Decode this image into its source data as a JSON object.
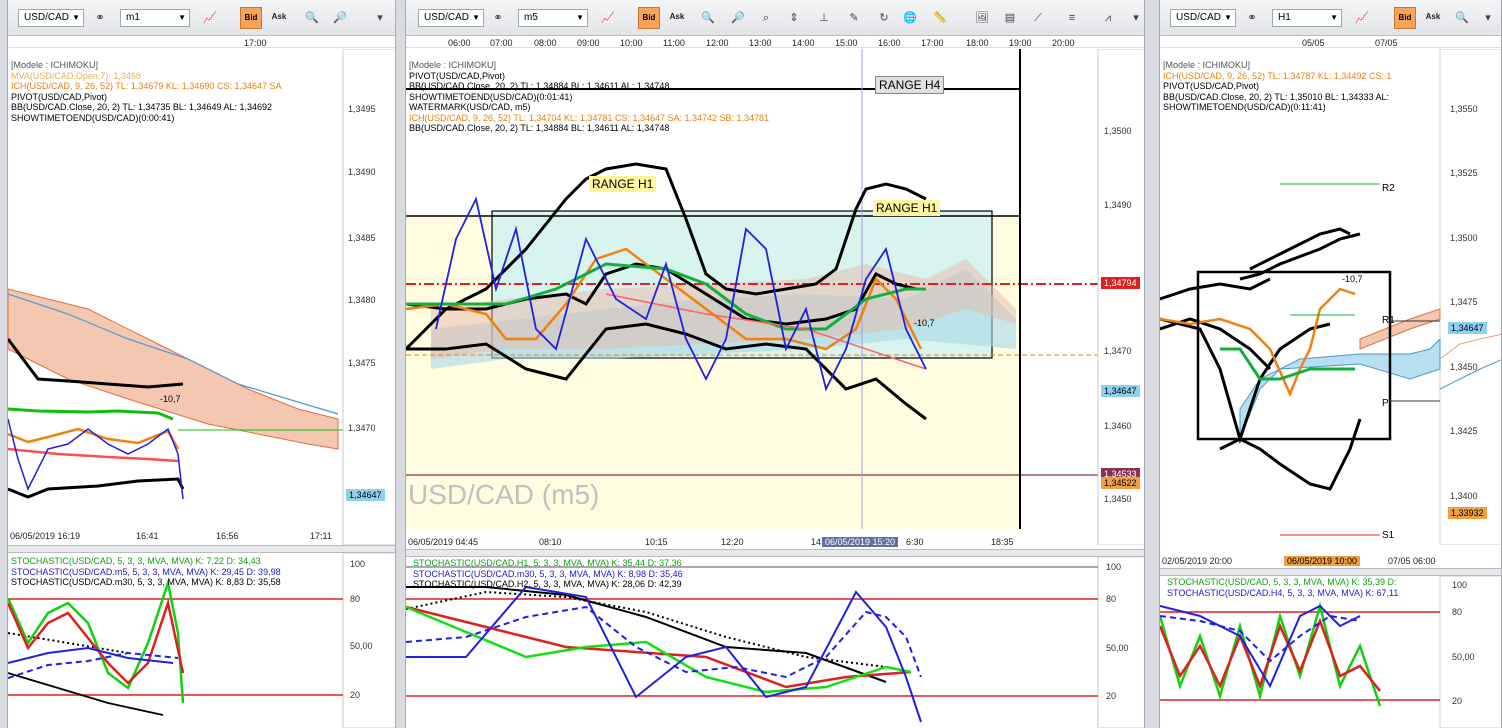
{
  "common": {
    "bid": "Bid",
    "ask": "Ask",
    "symbol": "USD/CAD",
    "stoch_labels": {
      "s100": "100",
      "s80": "80",
      "s50": "50,00",
      "s20": "20"
    }
  },
  "left": {
    "timeframe": "m1",
    "top_times": [
      "17:00"
    ],
    "legend": [
      {
        "text": "[Modele : ICHIMOKU]",
        "color": "#555555"
      },
      {
        "text": "MVA(USD/CAD.Open,7): 1,3468",
        "color": "#e0b060"
      },
      {
        "text": "ICH(USD/CAD, 9, 26, 52)  TL: 1,34679  KL: 1,34690  CS: 1,34647  SA",
        "color": "#e88010"
      },
      {
        "text": "PIVOT(USD/CAD,Pivot)",
        "color": "#000000"
      },
      {
        "text": "BB(USD/CAD.Close, 20, 2)  TL: 1,34735  BL: 1,34649  AL: 1,34692",
        "color": "#000000"
      },
      {
        "text": "SHOWTIMETOEND(USD/CAD)(0:00:41)",
        "color": "#000000"
      }
    ],
    "price_ticks": [
      "1,3495",
      "1,3490",
      "1,3485",
      "1,3480",
      "1,3475",
      "1,3470",
      "1,3465"
    ],
    "price_tag": "1,34647",
    "marker": "-10,7",
    "date_axis": [
      "06/05/2019 16:19",
      "16:41",
      "16:56",
      "17:11"
    ],
    "stoch_legend": [
      {
        "text": "STOCHASTIC(USD/CAD, 5, 3, 3, MVA, MVA)  K: 7,22  D: 34,43",
        "color": "#10a010"
      },
      {
        "text": "STOCHASTIC(USD/CAD.m5, 5, 3, 3, MVA, MVA)  K: 29,45  D: 39,98",
        "color": "#1a1ad0"
      },
      {
        "text": "STOCHASTIC(USD/CAD.m30, 5, 3, 3, MVA, MVA)  K: 8,83  D: 35,58",
        "color": "#000000"
      }
    ]
  },
  "mid": {
    "timeframe": "m5",
    "top_times": [
      "06:00",
      "07:00",
      "08:00",
      "09:00",
      "10:00",
      "11:00",
      "12:00",
      "13:00",
      "14:00",
      "15:00",
      "16:00",
      "17:00",
      "18:00",
      "19:00",
      "20:00"
    ],
    "legend": [
      {
        "text": "[Modele : ICHIMOKU]",
        "color": "#555555"
      },
      {
        "text": "PIVOT(USD/CAD,Pivot)",
        "color": "#000000"
      },
      {
        "text": "BB(USD/CAD.Close, 20, 2)  TL: 1,34884  BL: 1,34611  AL: 1,34748",
        "color": "#000000"
      },
      {
        "text": "SHOWTIMETOEND(USD/CAD)(0:01:41)",
        "color": "#000000"
      },
      {
        "text": "WATERMARK(USD/CAD, m5)",
        "color": "#000000"
      },
      {
        "text": "ICH(USD/CAD, 9, 26, 52)  TL: 1,34704  KL: 1,34781  CS: 1,34647  SA: 1,34742  SB: 1,34781",
        "color": "#e88010"
      },
      {
        "text": "BB(USD/CAD.Close, 20, 2)  TL: 1,34884  BL: 1,34611  AL: 1,34748",
        "color": "#000000"
      }
    ],
    "range_h4": "RANGE H4",
    "range_h1a": "RANGE H1",
    "range_h1b": "RANGE H1",
    "watermark": "USD/CAD (m5)",
    "price_ticks": [
      "1,3500",
      "1,3490",
      "1,3480",
      "1,3470",
      "1,3460",
      "1,3450"
    ],
    "tag_red": "1,34794",
    "tag_blue": "1,34647",
    "tag_pink": "1,34533",
    "tag_orange": "1,34522",
    "marker": "-10,7",
    "date_axis": [
      "06/05/2019 04:45",
      "08:10",
      "10:15",
      "12:20",
      "14",
      "06/05/2019 15:20",
      "6:30",
      "18:35"
    ],
    "stoch_legend": [
      {
        "text": "STOCHASTIC(USD/CAD.H1, 5, 3, 3, MVA, MVA)  K: 35,44  D: 37,36",
        "color": "#10a010"
      },
      {
        "text": "STOCHASTIC(USD/CAD.m30, 5, 3, 3, MVA, MVA)  K: 8,98  D: 35,46",
        "color": "#1a1ad0"
      },
      {
        "text": "STOCHASTIC(USD/CAD.H2, 5, 3, 3, MVA, MVA)  K: 28,06  D: 42,39",
        "color": "#000000"
      }
    ]
  },
  "right": {
    "timeframe": "H1",
    "top_times": [
      "05/05",
      "07/05"
    ],
    "legend": [
      {
        "text": "[Modele : ICHIMOKU]",
        "color": "#555555"
      },
      {
        "text": "ICH(USD/CAD, 9, 26, 52)  TL: 1,34787  KL: 1,34492  CS: 1",
        "color": "#e88010"
      },
      {
        "text": "PIVOT(USD/CAD,Pivot)",
        "color": "#000000"
      },
      {
        "text": "BB(USD/CAD.Close, 20, 2)  TL: 1,35010  BL: 1,34333  AL:",
        "color": "#000000"
      },
      {
        "text": "SHOWTIMETOEND(USD/CAD)(0:11:41)",
        "color": "#000000"
      }
    ],
    "price_ticks": [
      "1,3550",
      "1,3525",
      "1,3500",
      "1,3475",
      "1,3450",
      "1,3425",
      "1,3400"
    ],
    "tag_blue": "1,34647",
    "tag_orange": "1,33932",
    "marker": "-10,7",
    "levels": {
      "r2": "R2",
      "r1": "R1",
      "p": "P",
      "s1": "S1"
    },
    "date_axis": [
      "02/05/2019 20:00",
      "06/05/2019 10:00",
      "07/05 06:00"
    ],
    "stoch_legend": [
      {
        "text": "STOCHASTIC(USD/CAD, 5, 3, 3, MVA, MVA)  K: 35,39  D:",
        "color": "#10a010"
      },
      {
        "text": "STOCHASTIC(USD/CAD.H4, 5, 3, 3, MVA, MVA)  K: 67,11",
        "color": "#1a1ad0"
      }
    ]
  }
}
